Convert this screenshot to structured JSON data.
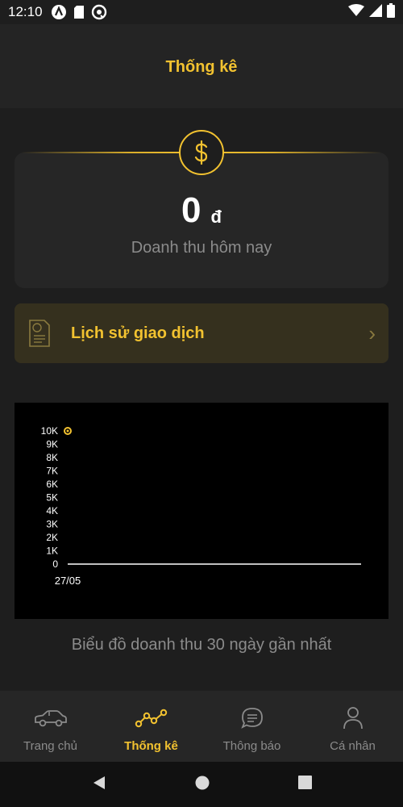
{
  "status_bar": {
    "time": "12:10",
    "icons": [
      "app-a-icon",
      "sd-card-icon",
      "at-sign-icon",
      "wifi-icon",
      "signal-icon",
      "battery-icon"
    ]
  },
  "header": {
    "title": "Thống kê"
  },
  "revenue": {
    "amount": "0",
    "currency": "đ",
    "label": "Doanh thu hôm nay",
    "icon": "dollar-icon"
  },
  "history": {
    "label": "Lịch sử giao dịch",
    "icon": "receipt-icon",
    "chevron": "›"
  },
  "chart_data": {
    "type": "line",
    "x": [
      "27/05"
    ],
    "series": [
      {
        "values": [
          0
        ]
      }
    ],
    "ytick_labels": [
      "10K",
      "9K",
      "8K",
      "7K",
      "6K",
      "5K",
      "4K",
      "3K",
      "2K",
      "1K",
      "0"
    ],
    "ylim": [
      0,
      10000
    ],
    "grid": false,
    "legend": "top-left",
    "colors": {
      "line": "#ffffff",
      "legend_marker": "#f2c230",
      "background": "#000000"
    }
  },
  "chart_caption": "Biểu đồ doanh thu 30 ngày gần nhất",
  "bottom_nav": {
    "items": [
      {
        "label": "Trang chủ",
        "icon": "car-icon",
        "active": false
      },
      {
        "label": "Thống kê",
        "icon": "chart-icon",
        "active": true
      },
      {
        "label": "Thông báo",
        "icon": "chat-icon",
        "active": false
      },
      {
        "label": "Cá nhân",
        "icon": "person-icon",
        "active": false
      }
    ]
  },
  "system_nav": [
    "back",
    "home",
    "recents"
  ],
  "colors": {
    "accent": "#f2c230",
    "background": "#1e1e1e",
    "muted_text": "#8b8b8b"
  }
}
